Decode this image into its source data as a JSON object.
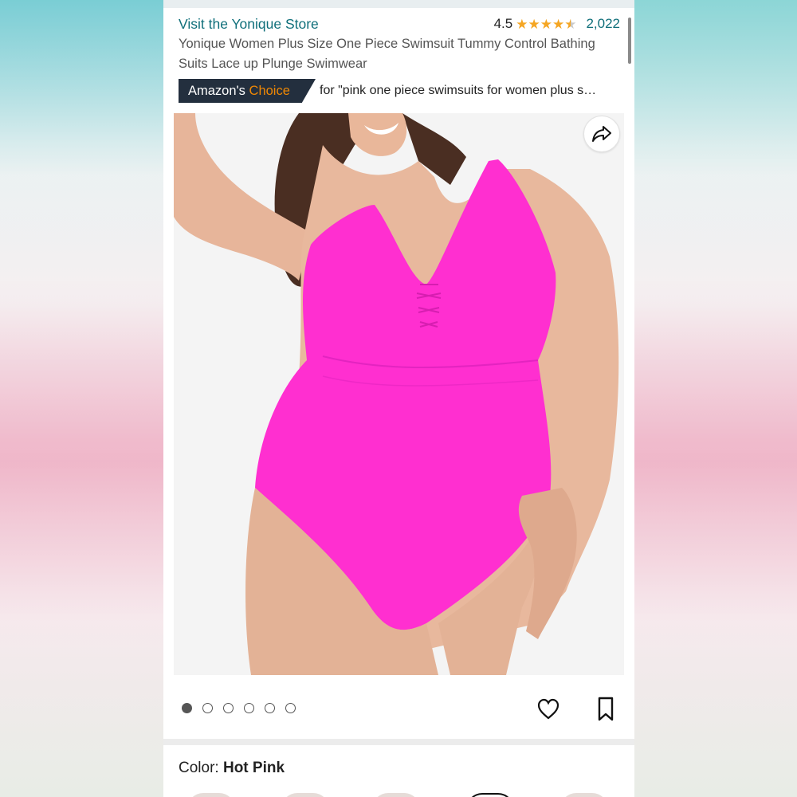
{
  "header": {
    "store_link": "Visit the Yonique Store",
    "rating_value": "4.5",
    "stars": 4.5,
    "review_count": "2,022",
    "product_title": "Yonique Women Plus Size One Piece Swimsuit Tummy Control Bathing Suits Lace up Plunge Swimwear",
    "badge_prefix": "Amazon's",
    "badge_accent": "Choice",
    "choice_for": "for \"pink one piece swimsuits for women plus s…"
  },
  "image": {
    "share_icon": "share-arrow-icon",
    "product_color": "#ff2fd0",
    "dots": {
      "total": 6,
      "active": 1
    },
    "heart_icon": "heart-icon",
    "bookmark_icon": "bookmark-icon"
  },
  "color_section": {
    "label": "Color: ",
    "value": "Hot Pink"
  },
  "colors": {
    "link": "#0f6f7a",
    "star": "#f5a623",
    "badge_bg": "#232f3e",
    "badge_accent": "#f08804"
  }
}
